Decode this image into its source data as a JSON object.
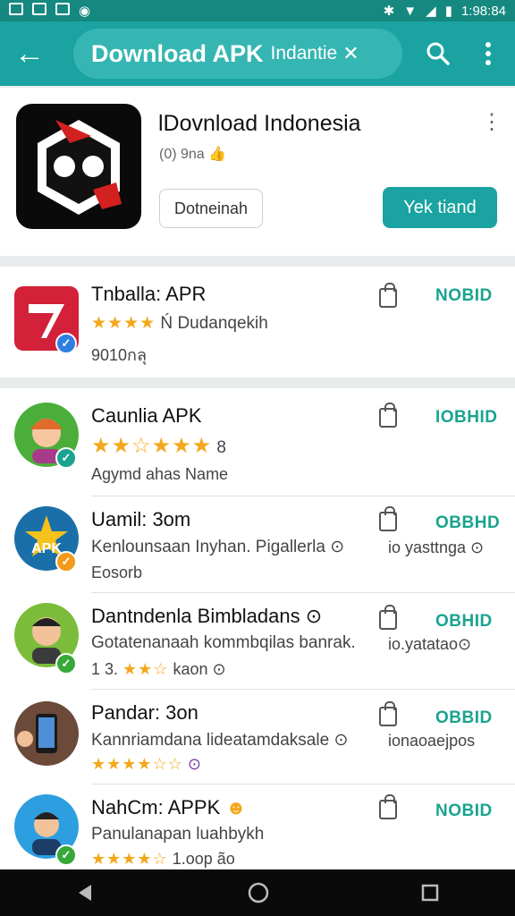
{
  "status": {
    "time": "1:98:84"
  },
  "search": {
    "query": "Download APK",
    "extra": "Indantie",
    "clear": "✕"
  },
  "hero": {
    "title": "lDovnload Indonesia",
    "subtitle": "(0) 9na",
    "outline_button": "Dotneinah",
    "primary_button": "Yek tiand"
  },
  "apps": [
    {
      "name": "Tnballa: APR",
      "stars": "★★★★",
      "line2": "Dudanqekih",
      "prefix2": "Ń",
      "line3": "9010กลุ",
      "action": "NOBID",
      "badge_color": "#2f7fe0"
    },
    {
      "name": "Caunlia APK",
      "stars": "★★☆★★★",
      "suffix2": "8",
      "line3": "Agymd ahas Name",
      "action": "IOBHID",
      "badge_color": "#1aa38f"
    },
    {
      "name": "Uamil: 3om",
      "line2": "Kenlounsaan Inyhan. Pigallerla ⊙",
      "side": "io yasttnga ⊙",
      "line3": "Eosorb",
      "action": "OBBHD",
      "badge_color": "#f39a1c"
    },
    {
      "name": "Dantndenla Bimbladans ⊙",
      "line2": "Gotatenanaah kommbqilas banrak.",
      "side": "io.yatatao⊙",
      "line3prefix": "1 3.",
      "stars": "★★☆",
      "line3": "kaon ⊙",
      "action": "OBHID",
      "badge_color": "#37a83a"
    },
    {
      "name": "Pandar: 3on",
      "line2": "Kannriamdana lideatamdaksale ⊙",
      "side": "ionaoaejpos",
      "stars": "★★★★☆☆",
      "line3": "⊙",
      "action": "OBBID",
      "badge_color": "#37a83a"
    },
    {
      "name": "NahCm: APPK",
      "line2": "Panulanapan luahbykh",
      "stars": "★★★★☆",
      "line3": "1.oop ão",
      "action": "NOBID",
      "badge_color": "#37a83a"
    }
  ]
}
